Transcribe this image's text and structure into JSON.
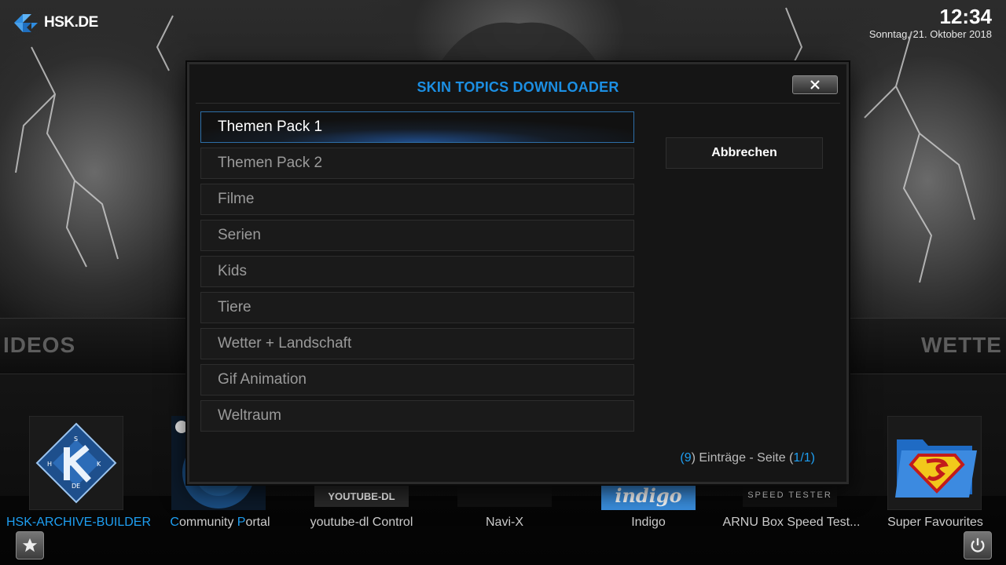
{
  "header": {
    "logo_text": "HSK.DE",
    "time": "12:34",
    "date": "Sonntag, 21. Oktober 2018"
  },
  "background": {
    "band_left": "IDEOS",
    "band_right": "WETTE"
  },
  "dialog": {
    "title": "SKIN TOPICS DOWNLOADER",
    "close_icon": "close-icon",
    "items": [
      {
        "label": "Themen Pack 1"
      },
      {
        "label": "Themen Pack 2"
      },
      {
        "label": "Filme"
      },
      {
        "label": "Serien"
      },
      {
        "label": "Kids"
      },
      {
        "label": "Tiere"
      },
      {
        "label": "Wetter + Landschaft"
      },
      {
        "label": "Gif Animation"
      },
      {
        "label": "Weltraum"
      }
    ],
    "cancel_label": "Abbrechen",
    "count": {
      "open_paren": "(",
      "num": "9",
      "middle": ") Einträge - Seite (",
      "page": "1/1",
      "close_paren": ")"
    }
  },
  "addons": [
    {
      "label": "HSK-ARCHIVE-BUILDER"
    },
    {
      "label_c": "C",
      "label_ommunity": "ommunity ",
      "label_p": "P",
      "label_ortal": "ortal"
    },
    {
      "label": "youtube-dl Control",
      "tile_text": "YOUTUBE-DL"
    },
    {
      "label": "Navi-X"
    },
    {
      "label": "Indigo",
      "tile_text": "indigo"
    },
    {
      "label": "ARNU Box Speed Test...",
      "tile_text": "SPEED TESTER"
    },
    {
      "label": "Super Favourites"
    }
  ],
  "bottom_buttons": {
    "favourites_icon": "star-icon",
    "power_icon": "power-icon"
  },
  "colors": {
    "accent": "#1c8fe3",
    "dialog_bg": "#151515"
  }
}
